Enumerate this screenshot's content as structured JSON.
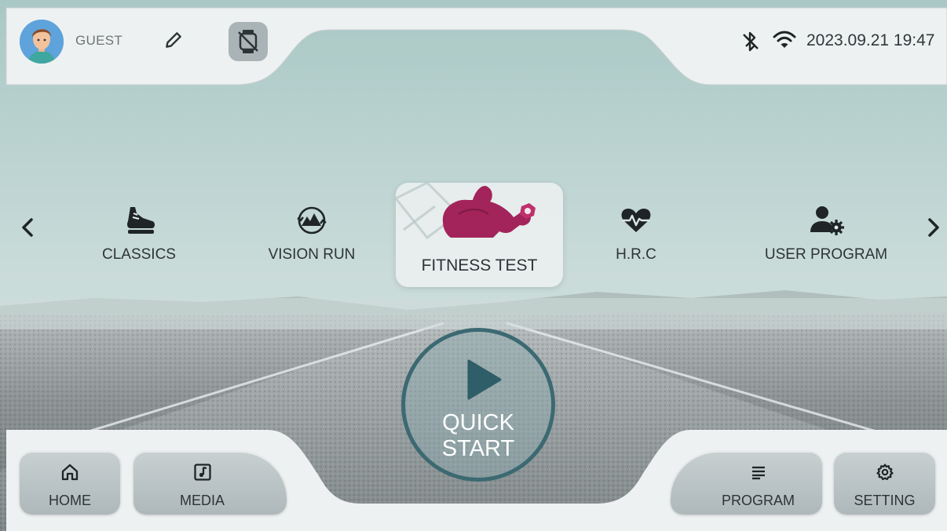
{
  "top_bar": {
    "user_name": "GUEST",
    "datetime": "2023.09.21 19:47"
  },
  "icons": {
    "avatar": "avatar-icon",
    "edit": "pencil-icon",
    "watch": "watch-disconnected-icon",
    "bluetooth": "bluetooth-off-icon",
    "wifi": "wifi-icon",
    "arrow_left": "chevron-left-icon",
    "arrow_right": "chevron-right-icon",
    "play": "play-icon"
  },
  "programs": [
    {
      "label": "CLASSICS",
      "icon": "running-shoe-icon"
    },
    {
      "label": "VISION RUN",
      "icon": "vision-run-icon"
    },
    {
      "label": "FITNESS TEST",
      "icon": "fitness-figure-icon",
      "selected": true
    },
    {
      "label": "H.R.C",
      "icon": "heart-rate-icon"
    },
    {
      "label": "USER PROGRAM",
      "icon": "user-settings-icon"
    }
  ],
  "quick_start": {
    "line1": "QUICK",
    "line2": "START"
  },
  "bottom_nav": {
    "home": {
      "label": "HOME",
      "icon": "home-icon"
    },
    "media": {
      "label": "MEDIA",
      "icon": "music-note-icon"
    },
    "program": {
      "label": "PROGRAM",
      "icon": "list-icon"
    },
    "setting": {
      "label": "SETTING",
      "icon": "gear-icon"
    }
  },
  "colors": {
    "accent_dark": "#3c6972",
    "fitness_figure": "#b0265f",
    "text": "#2d3436"
  }
}
